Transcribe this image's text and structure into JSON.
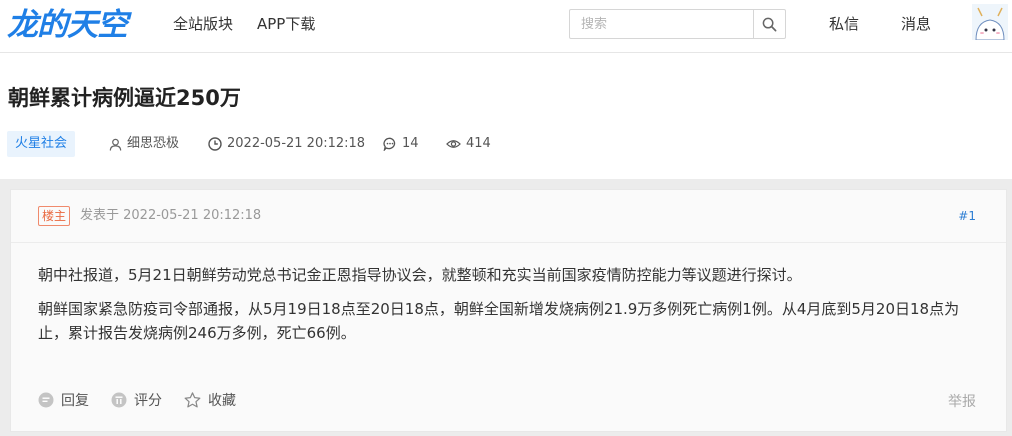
{
  "site": {
    "logo": "龙的天空"
  },
  "nav": {
    "items": [
      "全站版块",
      "APP下载"
    ]
  },
  "search": {
    "placeholder": "搜索"
  },
  "user_nav": {
    "messages": "私信",
    "notifications": "消息"
  },
  "thread": {
    "title": "朝鲜累计病例逼近250万",
    "board_tag": "火星社会",
    "author": "细思恐极",
    "datetime": "2022-05-21 20:12:18",
    "reply_count": "14",
    "view_count": "414"
  },
  "post": {
    "badge": "楼主",
    "posted_at": "发表于 2022-05-21 20:12:18",
    "floor": "#1",
    "paragraphs": [
      "朝中社报道，5月21日朝鲜劳动党总书记金正恩指导协议会，就整顿和充实当前国家疫情防控能力等议题进行探讨。",
      "朝鲜国家紧急防疫司令部通报，从5月19日18点至20日18点，朝鲜全国新增发烧病例21.9万多例死亡病例1例。从4月底到5月20日18点为止，累计报告发烧病例246万多例，死亡66例。"
    ],
    "actions": {
      "reply": "回复",
      "rate": "评分",
      "favorite": "收藏",
      "report": "举报"
    }
  },
  "colors": {
    "brand": "#1f7fe6",
    "tag_bg": "#e9f3fd",
    "badge": "#e9683f"
  },
  "icons": [
    "search-icon",
    "user-icon",
    "clock-icon",
    "comment-icon",
    "eye-icon",
    "reply-icon",
    "rate-icon",
    "star-icon"
  ]
}
